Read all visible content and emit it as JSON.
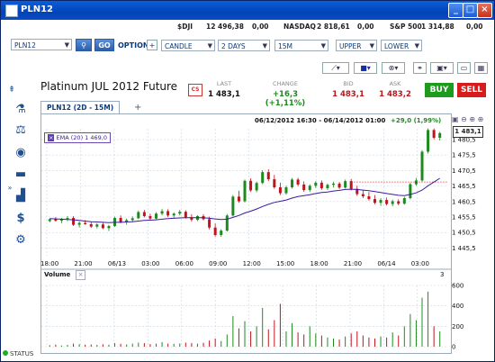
{
  "window": {
    "title": "PLN12"
  },
  "ticker": [
    {
      "label": "$DJI",
      "value": "12 496,38",
      "change": "0,00"
    },
    {
      "label": "NASDAQ",
      "value": "2 818,61",
      "change": "0,00"
    },
    {
      "label": "S&P 500",
      "value": "1 314,88",
      "change": "0,00"
    }
  ],
  "toolbar": {
    "symbol": "PLN12",
    "go_label": "GO",
    "option_label": "OPTION",
    "chart_type": "CANDLE",
    "range": "2 DAYS",
    "interval": "15M",
    "upper": "UPPER",
    "lower": "LOWER"
  },
  "instrument": {
    "name": "Platinum JUL 2012 Future",
    "cs_badge": "CS",
    "last_label": "LAST",
    "last": "1 483,1",
    "change_label": "CHANGE",
    "change": "+16,3 (+1,11%)",
    "bid_label": "BID",
    "bid": "1 483,1",
    "ask_label": "ASK",
    "ask": "1 483,2",
    "buy_label": "BUY",
    "sell_label": "SELL"
  },
  "tab": {
    "label": "PLN12 (2D - 15M)",
    "add": "+"
  },
  "chart_header": {
    "range": "06/12/2012 16:30 - 06/14/2012 01:00",
    "change": "+29,0 (1,99%)",
    "ema_label": "EMA (20) 1 469,0",
    "current_price": "1 483,1"
  },
  "volume_label": "Volume",
  "volume_pane_number": "3",
  "status": "STATUS",
  "colors": {
    "up": "#1e8a1e",
    "down": "#c0141c",
    "ema": "#3a1aa0",
    "grid": "#c9d6e6",
    "accent": "#0b3a7a"
  },
  "chart_data": {
    "type": "candlestick",
    "x_ticks": [
      "18:00",
      "21:00",
      "06/13",
      "03:00",
      "06:00",
      "09:00",
      "12:00",
      "15:00",
      "18:00",
      "21:00",
      "06/14",
      "03:00"
    ],
    "y_ticks": [
      "1 480,5",
      "1 475,5",
      "1 470,5",
      "1 465,5",
      "1 460,5",
      "1 455,5",
      "1 450,5",
      "1 445,5"
    ],
    "ylim": [
      1443,
      1484
    ],
    "volume_ticks": [
      "600",
      "400",
      "200",
      "0"
    ],
    "volume_ylim": [
      0,
      600
    ],
    "reference_line": 1466.8,
    "candles": [
      [
        1454.2,
        1455.0,
        1453.8,
        1454.8
      ],
      [
        1454.8,
        1455.5,
        1454.0,
        1454.3
      ],
      [
        1454.3,
        1455.2,
        1453.5,
        1454.9
      ],
      [
        1454.9,
        1455.8,
        1454.2,
        1455.2
      ],
      [
        1455.2,
        1455.8,
        1452.6,
        1453.0
      ],
      [
        1453.0,
        1454.1,
        1452.1,
        1453.6
      ],
      [
        1453.6,
        1454.5,
        1453.0,
        1453.2
      ],
      [
        1453.2,
        1453.9,
        1452.0,
        1452.4
      ],
      [
        1452.4,
        1453.5,
        1451.8,
        1453.1
      ],
      [
        1453.1,
        1453.6,
        1451.6,
        1451.9
      ],
      [
        1451.9,
        1453.0,
        1451.0,
        1452.6
      ],
      [
        1452.6,
        1455.6,
        1452.3,
        1455.2
      ],
      [
        1455.2,
        1456.0,
        1453.5,
        1453.9
      ],
      [
        1453.9,
        1455.0,
        1453.0,
        1454.5
      ],
      [
        1454.5,
        1455.7,
        1454.0,
        1455.1
      ],
      [
        1455.1,
        1457.6,
        1454.8,
        1457.1
      ],
      [
        1457.1,
        1457.8,
        1455.4,
        1455.8
      ],
      [
        1455.8,
        1456.6,
        1454.6,
        1455.0
      ],
      [
        1455.0,
        1457.1,
        1454.7,
        1456.6
      ],
      [
        1456.6,
        1458.1,
        1456.1,
        1457.4
      ],
      [
        1457.4,
        1458.0,
        1455.5,
        1456.0
      ],
      [
        1456.0,
        1457.0,
        1455.1,
        1456.6
      ],
      [
        1456.6,
        1457.8,
        1456.0,
        1457.2
      ],
      [
        1457.2,
        1457.7,
        1455.0,
        1455.4
      ],
      [
        1455.4,
        1456.4,
        1454.0,
        1454.6
      ],
      [
        1454.6,
        1456.1,
        1454.2,
        1455.8
      ],
      [
        1455.8,
        1456.4,
        1454.4,
        1454.8
      ],
      [
        1454.8,
        1455.6,
        1451.5,
        1452.1
      ],
      [
        1452.1,
        1453.4,
        1449.2,
        1449.7
      ],
      [
        1449.7,
        1451.6,
        1449.1,
        1451.1
      ],
      [
        1451.1,
        1456.5,
        1450.8,
        1456.0
      ],
      [
        1456.0,
        1462.6,
        1455.7,
        1462.1
      ],
      [
        1462.1,
        1464.0,
        1460.1,
        1460.6
      ],
      [
        1460.6,
        1467.6,
        1460.2,
        1467.2
      ],
      [
        1467.2,
        1468.0,
        1463.6,
        1464.1
      ],
      [
        1464.1,
        1467.0,
        1463.5,
        1466.5
      ],
      [
        1466.5,
        1470.6,
        1466.1,
        1470.0
      ],
      [
        1470.0,
        1470.9,
        1467.1,
        1467.7
      ],
      [
        1467.7,
        1469.1,
        1464.6,
        1465.1
      ],
      [
        1465.1,
        1466.6,
        1462.6,
        1463.2
      ],
      [
        1463.2,
        1465.6,
        1462.7,
        1465.1
      ],
      [
        1465.1,
        1468.1,
        1464.7,
        1467.6
      ],
      [
        1467.6,
        1468.2,
        1465.5,
        1466.0
      ],
      [
        1466.0,
        1467.0,
        1463.7,
        1464.2
      ],
      [
        1464.2,
        1466.1,
        1463.6,
        1465.6
      ],
      [
        1465.6,
        1467.1,
        1464.9,
        1466.6
      ],
      [
        1466.6,
        1467.3,
        1464.3,
        1464.8
      ],
      [
        1464.8,
        1466.3,
        1464.2,
        1465.9
      ],
      [
        1465.9,
        1466.9,
        1465.0,
        1466.3
      ],
      [
        1466.3,
        1466.8,
        1464.6,
        1465.0
      ],
      [
        1465.0,
        1467.6,
        1464.7,
        1467.1
      ],
      [
        1467.1,
        1467.8,
        1464.1,
        1464.6
      ],
      [
        1464.6,
        1465.6,
        1462.3,
        1462.9
      ],
      [
        1462.9,
        1464.1,
        1461.6,
        1462.2
      ],
      [
        1462.2,
        1463.6,
        1460.8,
        1461.3
      ],
      [
        1461.3,
        1462.6,
        1459.6,
        1460.1
      ],
      [
        1460.1,
        1461.6,
        1459.1,
        1461.0
      ],
      [
        1461.0,
        1461.8,
        1459.2,
        1459.7
      ],
      [
        1459.7,
        1461.1,
        1459.0,
        1460.6
      ],
      [
        1460.6,
        1461.2,
        1459.3,
        1459.8
      ],
      [
        1459.8,
        1462.0,
        1459.5,
        1461.6
      ],
      [
        1461.6,
        1466.6,
        1461.2,
        1466.1
      ],
      [
        1466.1,
        1468.1,
        1465.6,
        1467.3
      ],
      [
        1467.3,
        1477.1,
        1467.0,
        1476.6
      ],
      [
        1476.6,
        1484.1,
        1476.0,
        1483.6
      ],
      [
        1483.6,
        1484.1,
        1480.6,
        1481.1
      ],
      [
        1481.1,
        1483.0,
        1480.2,
        1482.6
      ]
    ],
    "ema": [
      1455.0,
      1454.9,
      1454.8,
      1454.7,
      1454.6,
      1454.4,
      1454.2,
      1454.0,
      1453.9,
      1453.8,
      1453.7,
      1453.8,
      1453.8,
      1453.9,
      1454.0,
      1454.2,
      1454.4,
      1454.5,
      1454.6,
      1454.8,
      1455.0,
      1455.1,
      1455.2,
      1455.3,
      1455.3,
      1455.3,
      1455.3,
      1455.1,
      1454.9,
      1454.7,
      1454.8,
      1455.4,
      1456.0,
      1456.8,
      1457.4,
      1458.1,
      1458.9,
      1459.6,
      1460.2,
      1460.6,
      1461.0,
      1461.6,
      1462.1,
      1462.4,
      1462.7,
      1463.1,
      1463.4,
      1463.6,
      1463.9,
      1464.1,
      1464.4,
      1464.5,
      1464.4,
      1464.2,
      1464.0,
      1463.7,
      1463.4,
      1463.1,
      1462.8,
      1462.5,
      1462.4,
      1462.8,
      1463.3,
      1464.2,
      1465.6,
      1466.8,
      1468.0
    ],
    "volumes": [
      15,
      20,
      12,
      18,
      30,
      25,
      20,
      22,
      18,
      24,
      20,
      35,
      28,
      22,
      30,
      40,
      35,
      25,
      30,
      45,
      30,
      28,
      32,
      40,
      35,
      30,
      38,
      60,
      80,
      55,
      120,
      300,
      180,
      250,
      150,
      200,
      380,
      170,
      260,
      420,
      150,
      230,
      140,
      120,
      200,
      130,
      110,
      90,
      80,
      70,
      100,
      130,
      150,
      110,
      90,
      80,
      100,
      90,
      140,
      110,
      200,
      320,
      260,
      480,
      540,
      200,
      150
    ]
  }
}
